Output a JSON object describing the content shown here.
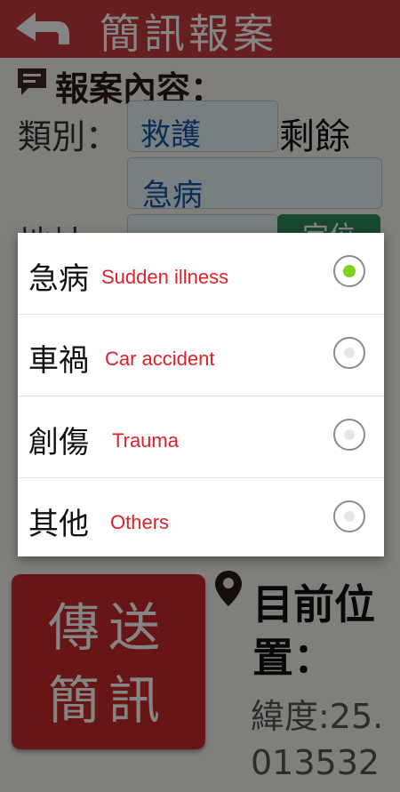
{
  "header": {
    "title": "簡訊報案",
    "back_icon": "back-arrow-icon"
  },
  "form": {
    "section_title": "報案內容：",
    "category_label": "類別：",
    "category_value": "救護",
    "remaining_label": "剩餘",
    "subcategory_value": "急病",
    "address_label": "地址：",
    "locate_button": "定位"
  },
  "send_button": {
    "line1": "傳送",
    "line2": "簡訊"
  },
  "location": {
    "title": "目前位置：",
    "latitude": "緯度:25.013532"
  },
  "dialog": {
    "options": [
      {
        "zh": "急病",
        "en": "Sudden illness",
        "selected": true
      },
      {
        "zh": "車禍",
        "en": "Car accident",
        "selected": false
      },
      {
        "zh": "創傷",
        "en": "Trauma",
        "selected": false
      },
      {
        "zh": "其他",
        "en": "Others",
        "selected": false
      }
    ]
  },
  "colors": {
    "header_red": "#c33a3a",
    "send_red": "#c72a2a",
    "annotation_red": "#e0202a",
    "radio_green": "#7ed321"
  }
}
